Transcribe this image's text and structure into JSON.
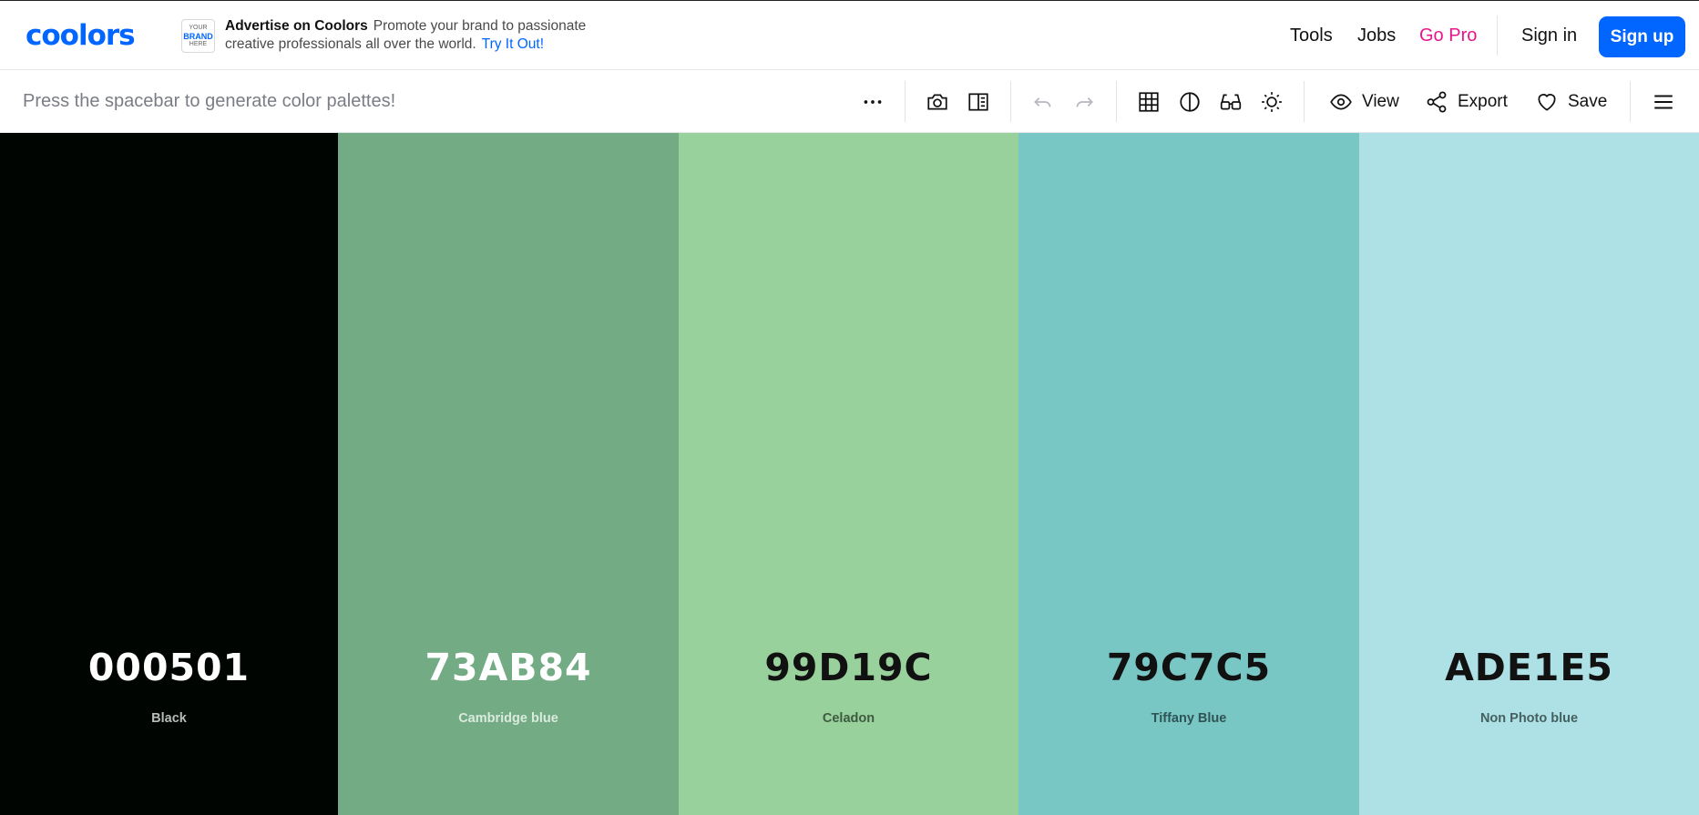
{
  "navbar": {
    "logo_text": "coolors",
    "ad": {
      "badge_lines": [
        "YOUR",
        "BRAND",
        "HERE"
      ],
      "title": "Advertise on Coolors",
      "body": "Promote your brand to passionate creative professionals all over the world.",
      "link": "Try It Out!"
    },
    "links": {
      "tools": "Tools",
      "jobs": "Jobs",
      "gopro": "Go Pro",
      "signin": "Sign in",
      "signup": "Sign up"
    },
    "colors": {
      "accent": "#0066ff",
      "gopro": "#e8158c"
    }
  },
  "toolbar": {
    "hint": "Press the spacebar to generate color palettes!",
    "icons": [
      "more-icon",
      "camera-icon",
      "split-view-icon",
      "undo-icon",
      "redo-icon",
      "grid-icon",
      "contrast-icon",
      "glasses-icon",
      "brightness-icon"
    ],
    "view_label": "View",
    "export_label": "Export",
    "save_label": "Save"
  },
  "palette": [
    {
      "hex": "000501",
      "name": "Black",
      "bg": "#000501",
      "hex_color": "#ffffff",
      "name_color": "#b9bcba"
    },
    {
      "hex": "73AB84",
      "name": "Cambridge blue",
      "bg": "#73AB84",
      "hex_color": "#ffffff",
      "name_color": "#d9ebdd"
    },
    {
      "hex": "99D19C",
      "name": "Celadon",
      "bg": "#99D19C",
      "hex_color": "#111111",
      "name_color": "#3e5a40"
    },
    {
      "hex": "79C7C5",
      "name": "Tiffany Blue",
      "bg": "#79C7C5",
      "hex_color": "#111111",
      "name_color": "#2f5453"
    },
    {
      "hex": "ADE1E5",
      "name": "Non Photo blue",
      "bg": "#ADE1E5",
      "hex_color": "#111111",
      "name_color": "#46605f"
    }
  ]
}
